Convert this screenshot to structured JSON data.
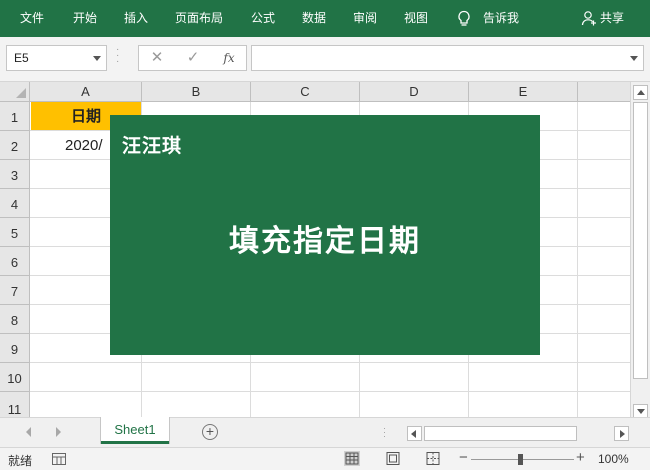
{
  "ribbon": {
    "tabs": [
      "文件",
      "开始",
      "插入",
      "页面布局",
      "公式",
      "数据",
      "审阅",
      "视图"
    ],
    "tell_me": "告诉我",
    "share": "共享",
    "bg_color": "#217346"
  },
  "formula_bar": {
    "name_box": "E5",
    "cancel_glyph": "✕",
    "enter_glyph": "✓",
    "fx_glyph": "fx",
    "formula_value": ""
  },
  "grid": {
    "columns": [
      "A",
      "B",
      "C",
      "D",
      "E"
    ],
    "rows": [
      "1",
      "2",
      "3",
      "4",
      "5",
      "6",
      "7",
      "8",
      "9",
      "10",
      "11"
    ],
    "cells": {
      "a1": "日期",
      "a2": "2020/"
    },
    "header_fill": "#ffc000"
  },
  "card": {
    "author": "汪汪琪",
    "headline": "填充指定日期",
    "bg_color": "#217346"
  },
  "sheets": {
    "tabs": [
      "Sheet1"
    ],
    "add_glyph": "+"
  },
  "status": {
    "ready": "就绪",
    "zoom_minus": "−",
    "zoom_plus": "+",
    "zoom": "100%"
  }
}
